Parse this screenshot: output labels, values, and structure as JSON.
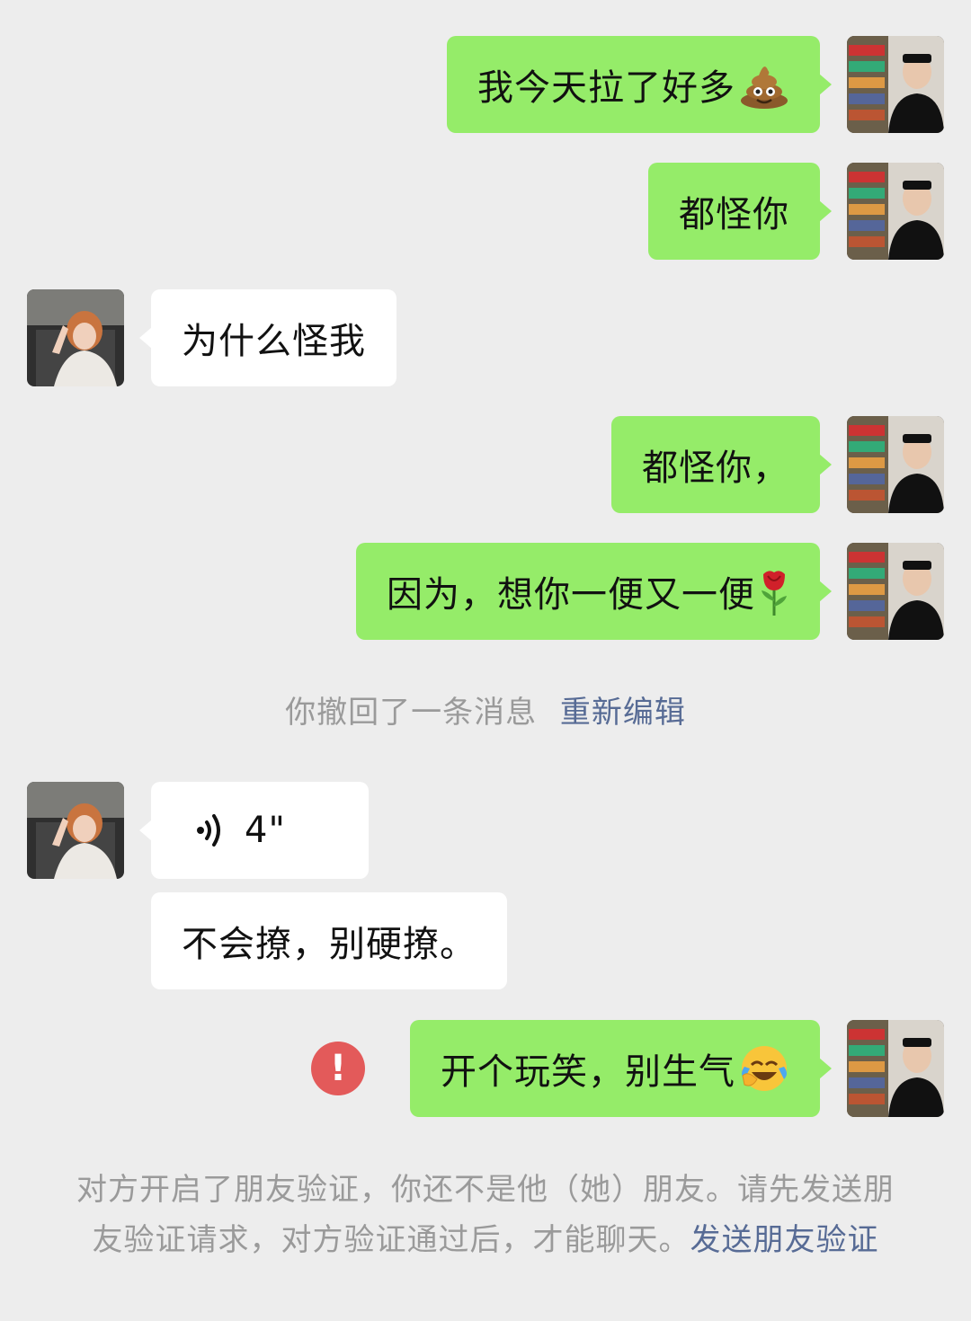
{
  "messages": [
    {
      "sender": "me",
      "text": "我今天拉了好多",
      "emoji": "pile-of-poo"
    },
    {
      "sender": "me",
      "text": "都怪你"
    },
    {
      "sender": "them",
      "text": "为什么怪我"
    },
    {
      "sender": "me",
      "text": "都怪你，"
    },
    {
      "sender": "me",
      "text": "因为，想你一便又一便",
      "emoji": "rose"
    },
    {
      "sender": "them",
      "type": "voice",
      "text": "4\""
    },
    {
      "sender": "them",
      "text": "不会撩，别硬撩。"
    },
    {
      "sender": "me",
      "text": "开个玩笑，别生气",
      "emoji": "face-with-tears-of-joy",
      "status": "failed"
    }
  ],
  "recall_notice": {
    "text": "你撤回了一条消息",
    "action": "重新编辑"
  },
  "friend_verification": {
    "text": "对方开启了朋友验证，你还不是他（她）朋友。请先发送朋友验证请求，对方验证通过后，才能聊天。",
    "action": "发送朋友验证"
  },
  "colors": {
    "background": "#ededed",
    "my_bubble": "#95ec69",
    "their_bubble": "#ffffff",
    "link": "#576b95",
    "system_text": "#9a9a9a",
    "error": "#e35a5a"
  },
  "icons": {
    "voice": "voice-wave-icon",
    "error": "exclamation-error-icon"
  }
}
